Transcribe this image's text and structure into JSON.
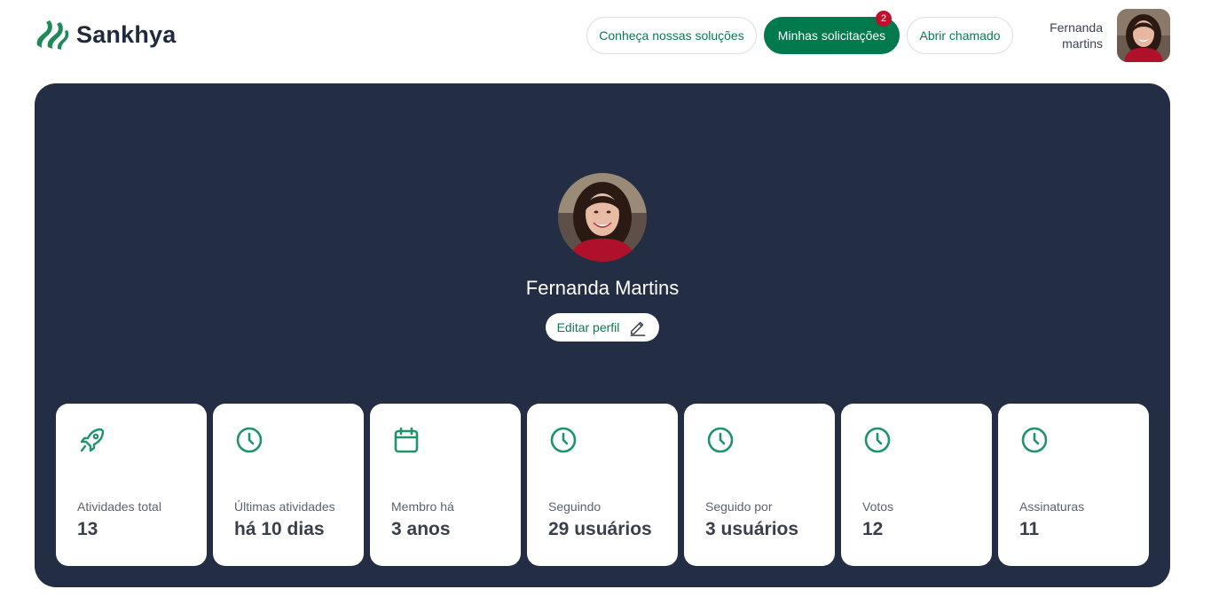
{
  "brand": {
    "name": "Sankhya",
    "primary_color": "#007a4d",
    "panel_color": "#232e44"
  },
  "nav": {
    "items": [
      {
        "label": "Conheça nossas soluções"
      },
      {
        "label": "Minhas solicitações",
        "badge": "2"
      },
      {
        "label": "Abrir chamado"
      }
    ]
  },
  "user": {
    "name_line1": "Fernanda",
    "name_line2": "martins"
  },
  "profile": {
    "name": "Fernanda Martins",
    "edit_label": "Editar perfil"
  },
  "stats": [
    {
      "icon": "rocket-icon",
      "label": "Atividades total",
      "value": "13"
    },
    {
      "icon": "clock-icon",
      "label": "Últimas atividades",
      "value": "há 10 dias"
    },
    {
      "icon": "calendar-icon",
      "label": "Membro há",
      "value": "3 anos"
    },
    {
      "icon": "clock-icon",
      "label": "Seguindo",
      "value": "29 usuários"
    },
    {
      "icon": "clock-icon",
      "label": "Seguido por",
      "value": "3 usuários"
    },
    {
      "icon": "clock-icon",
      "label": "Votos",
      "value": "12"
    },
    {
      "icon": "clock-icon",
      "label": "Assinaturas",
      "value": "11"
    }
  ]
}
